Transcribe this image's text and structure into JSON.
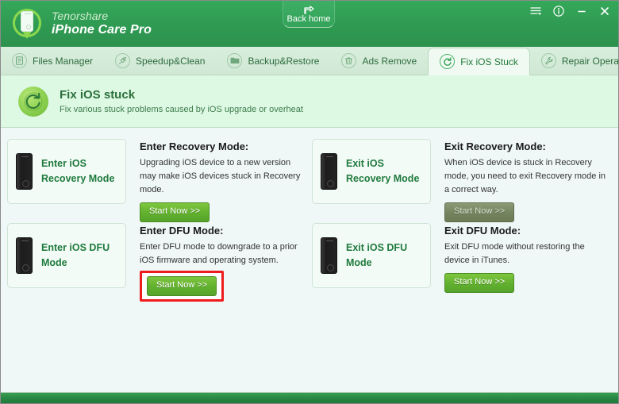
{
  "window": {
    "brand_line1": "Tenorshare",
    "brand_line2": "iPhone Care Pro",
    "logo_icon": "phone-pin-logo-icon",
    "back_home_label": "Back home",
    "back_home_icon": "back-home-icon",
    "controls": [
      {
        "name": "menu-button",
        "icon": "menu-lines-icon",
        "glyph": "☰"
      },
      {
        "name": "info-button",
        "icon": "info-circle-icon",
        "glyph": "ⓘ"
      },
      {
        "name": "minimize-button",
        "icon": "minimize-icon",
        "glyph": "─"
      },
      {
        "name": "close-button",
        "icon": "close-x-icon",
        "glyph": "✕"
      }
    ]
  },
  "colors": {
    "header_green": "#2f9a52",
    "accent_green": "#1f7a3d",
    "button_green": "#63b22f",
    "button_disabled": "#75855f",
    "highlight_red": "#ee1c1c",
    "banner_bg": "#ddf8e3",
    "body_bg": "#eff7f7"
  },
  "tabs": [
    {
      "label": "Files Manager",
      "icon": "files-manager-icon",
      "active": false
    },
    {
      "label": "Speedup&Clean",
      "icon": "rocket-icon",
      "active": false
    },
    {
      "label": "Backup&Restore",
      "icon": "folder-icon",
      "active": false
    },
    {
      "label": "Ads Remove",
      "icon": "trash-icon",
      "active": false
    },
    {
      "label": "Fix iOS Stuck",
      "icon": "refresh-circle-icon",
      "active": true
    },
    {
      "label": "Repair Operating System",
      "icon": "wrench-icon",
      "active": false
    }
  ],
  "banner": {
    "icon": "refresh-circle-icon",
    "title": "Fix iOS stuck",
    "subtitle": "Fix various stuck problems caused by iOS upgrade or overheat"
  },
  "cards": [
    {
      "device_label": "Enter iOS Recovery Mode",
      "device_icon": "iphone-icon",
      "title": "Enter Recovery Mode:",
      "description": "Upgrading iOS device to a new version may make iOS devices stuck in Recovery mode.",
      "button_label": "Start Now >>",
      "button_state": "enabled",
      "highlighted": false
    },
    {
      "device_label": "Exit iOS Recovery Mode",
      "device_icon": "iphone-icon",
      "title": "Exit Recovery Mode:",
      "description": "When iOS device is stuck in Recovery mode, you need to exit Recovery mode in a correct way.",
      "button_label": "Start Now >>",
      "button_state": "disabled",
      "highlighted": false
    },
    {
      "device_label": "Enter iOS DFU Mode",
      "device_icon": "iphone-icon",
      "title": "Enter DFU Mode:",
      "description": "Enter DFU mode to downgrade to a prior iOS firmware and operating system.",
      "button_label": "Start Now >>",
      "button_state": "enabled",
      "highlighted": true
    },
    {
      "device_label": "Exit iOS DFU Mode",
      "device_icon": "iphone-icon",
      "title": "Exit DFU Mode:",
      "description": "Exit DFU mode without restoring the device in iTunes.",
      "button_label": "Start Now >>",
      "button_state": "enabled",
      "highlighted": false
    }
  ]
}
